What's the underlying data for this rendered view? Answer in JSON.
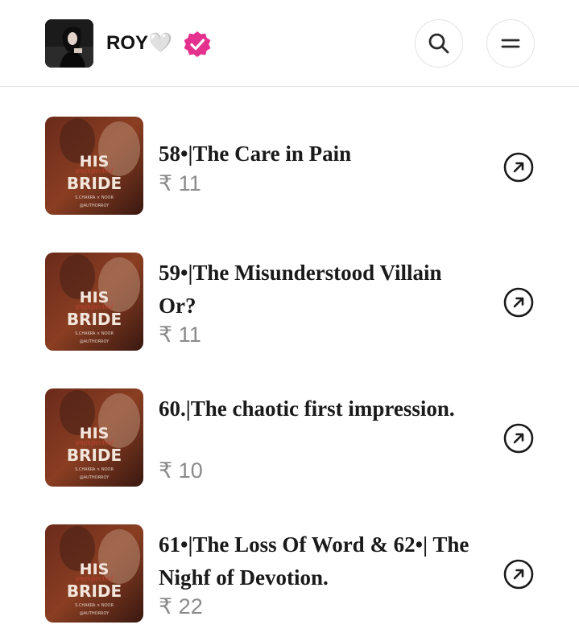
{
  "header": {
    "creator_name": "ROY🤍",
    "avatar_icon": "profile-photo",
    "verified_icon": "verified-badge-icon",
    "verified_color": "#e5318e",
    "search_icon": "search-icon",
    "menu_icon": "menu-icon"
  },
  "cover": {
    "title_line1": "HIS",
    "title_line2": "BRIDE",
    "script_text": "unexpected",
    "credit_line1": "S.CHAKRA × NOOR",
    "credit_line2": "@AUTHORROY"
  },
  "episodes": [
    {
      "title": "58•|The Care in Pain",
      "price": "₹ 11"
    },
    {
      "title": "59•|The Misunderstood Villain Or?",
      "price": "₹ 11"
    },
    {
      "title": "60.|The chaotic first impression.",
      "price": "₹ 10"
    },
    {
      "title": "61•|The Loss Of Word & 62•| The Nighf of Devotion.",
      "price": "₹ 22"
    }
  ]
}
